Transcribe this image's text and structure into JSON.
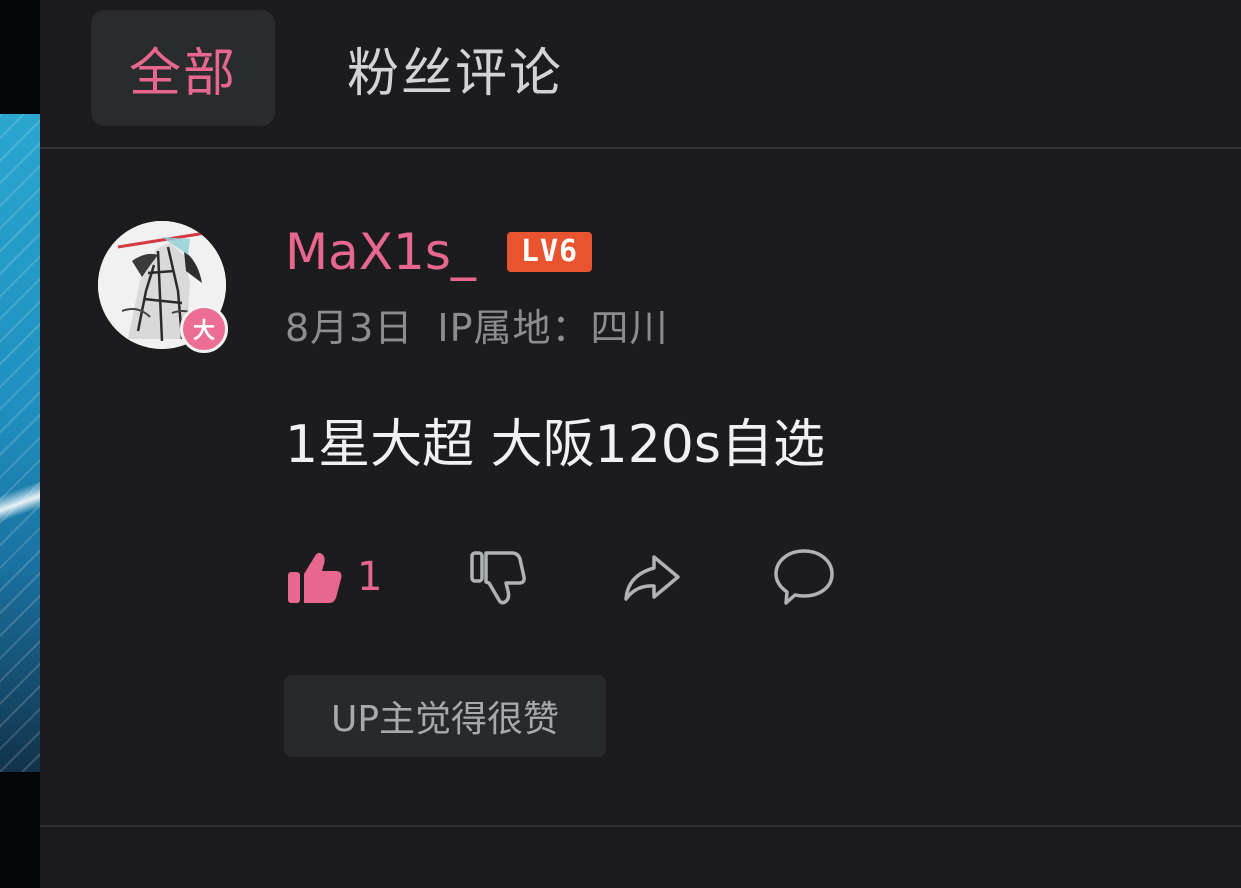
{
  "tabs": [
    {
      "label": "全部",
      "active": true
    },
    {
      "label": "粉丝评论",
      "active": false
    }
  ],
  "comment": {
    "avatar_badge": "大",
    "username": "MaX1s_",
    "level": "LV6",
    "date": "8月3日",
    "ip_location": "IP属地：四川",
    "text": "1星大超 大阪120s自选",
    "like_count": "1",
    "up_liked_label": "UP主觉得很赞",
    "icons": {
      "like": "thumbs-up-filled-icon",
      "dislike": "thumbs-down-icon",
      "share": "share-arrow-icon",
      "reply": "speech-bubble-icon"
    }
  },
  "colors": {
    "accent": "#e8678e",
    "background": "#1c1c1e",
    "level_badge": "#e8542f"
  }
}
